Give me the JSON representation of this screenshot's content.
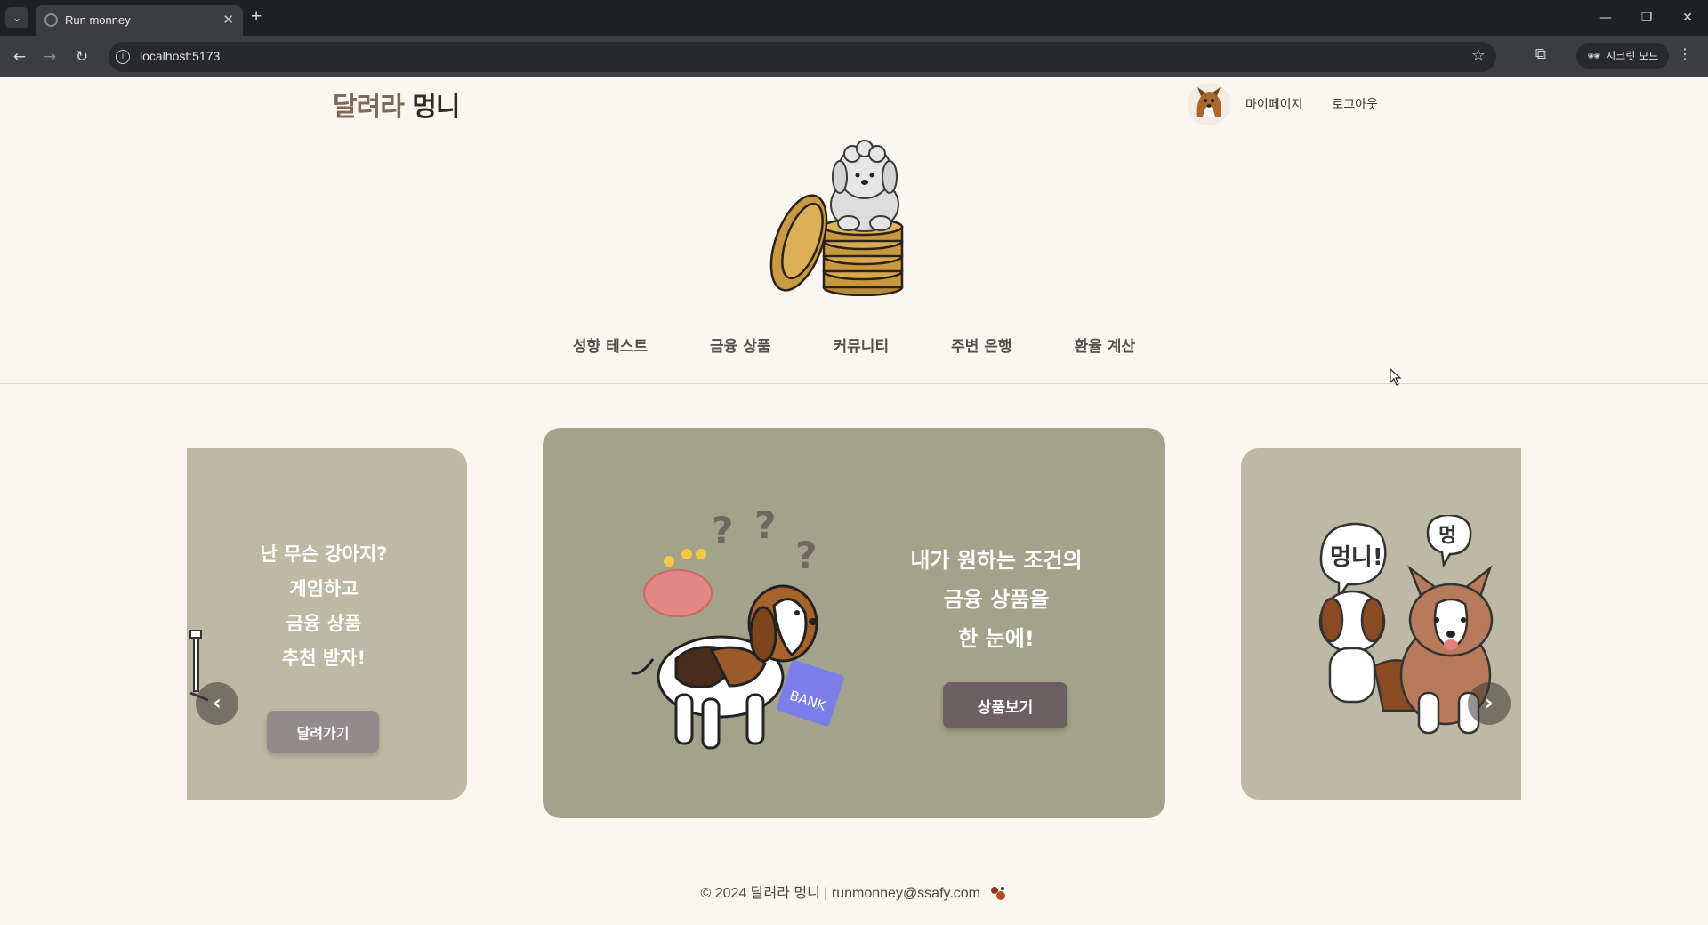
{
  "browser": {
    "tab_title": "Run monney",
    "url": "localhost:5173",
    "incognito_label": "시크릿 모드"
  },
  "header": {
    "logo_part1": "달려라",
    "logo_part2": "멍니",
    "mypage": "마이페이지",
    "logout": "로그아웃"
  },
  "nav": {
    "items": [
      "성향 테스트",
      "금융 상품",
      "커뮤니티",
      "주변 은행",
      "환율 계산"
    ]
  },
  "carousel": {
    "left": {
      "lines": [
        "난 무슨 강아지?",
        "게임하고",
        "금융 상품",
        "추천 받자!"
      ],
      "button": "달려가기"
    },
    "center": {
      "lines": [
        "내가 원하는 조건의",
        "금융 상품을",
        "한 눈에!"
      ],
      "button": "상품보기",
      "bank_label": "BANK"
    },
    "right": {
      "bubble1": "멍니!",
      "bubble2": "멍"
    },
    "prev_label": "‹",
    "next_label": "›"
  },
  "footer": {
    "text": "© 2024 달려라 멍니 | runmonney@ssafy.com"
  }
}
